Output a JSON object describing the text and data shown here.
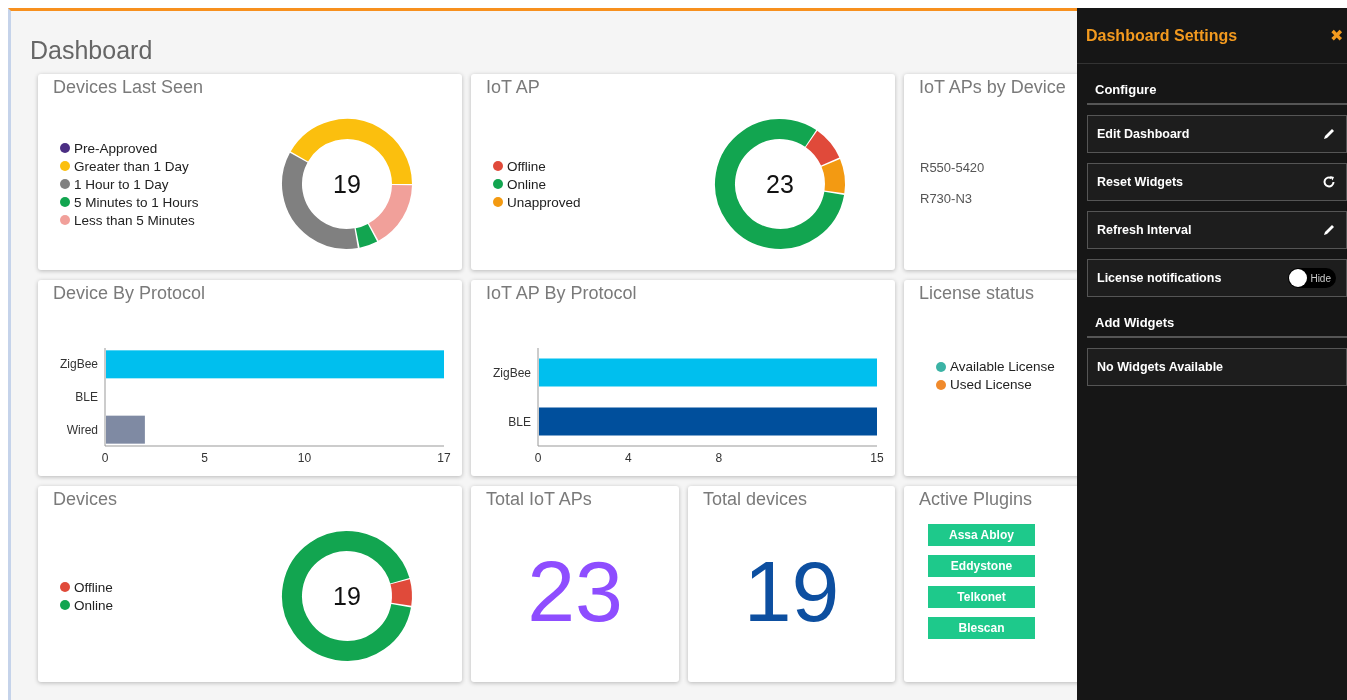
{
  "page": {
    "title": "Dashboard"
  },
  "widgets": [
    {
      "kind": "donut",
      "title": "Devices Last Seen",
      "total": "19",
      "legend": [
        {
          "label": "Pre-Approved",
          "color": "#4b2e83"
        },
        {
          "label": "Greater than 1 Day",
          "color": "#fbbf0e"
        },
        {
          "label": "1 Hour to 1 Day",
          "color": "#808080"
        },
        {
          "label": "5 Minutes to 1 Hours",
          "color": "#12a550"
        },
        {
          "label": "Less than 5 Minutes",
          "color": "#f1a09a"
        }
      ]
    },
    {
      "kind": "donut",
      "title": "IoT AP",
      "total": "23",
      "legend": [
        {
          "label": "Offline",
          "color": "#e04a3a"
        },
        {
          "label": "Online",
          "color": "#12a550"
        },
        {
          "label": "Unapproved",
          "color": "#f39a12"
        }
      ]
    },
    {
      "kind": "list",
      "title": "IoT APs by Device",
      "items": [
        "R550-5420",
        "R730-N3"
      ]
    },
    {
      "kind": "bar",
      "title": "Device By Protocol",
      "chart_data": {
        "type": "bar",
        "orientation": "horizontal",
        "categories": [
          "ZigBee",
          "BLE",
          "Wired"
        ],
        "series": [
          {
            "color": "#00bfee",
            "values": [
              17,
              null,
              null
            ]
          },
          {
            "color": "#7f8aa3",
            "values": [
              null,
              null,
              2
            ]
          }
        ],
        "xlim": [
          0,
          17
        ],
        "xticks": [
          0,
          5,
          10,
          17
        ]
      }
    },
    {
      "kind": "bar",
      "title": "IoT AP By Protocol",
      "chart_data": {
        "type": "bar",
        "orientation": "horizontal",
        "categories": [
          "ZigBee",
          "BLE"
        ],
        "series": [
          {
            "color": "#00bfee",
            "values": [
              15,
              null
            ]
          },
          {
            "color": "#004f9c",
            "values": [
              null,
              15
            ]
          }
        ],
        "xlim": [
          0,
          15
        ],
        "xticks": [
          0,
          4,
          8,
          15
        ]
      }
    },
    {
      "kind": "legend",
      "title": "License status",
      "legend": [
        {
          "label": "Available License",
          "color": "#3bb3a5"
        },
        {
          "label": "Used License",
          "color": "#f08a2c"
        }
      ]
    },
    {
      "kind": "donut",
      "title": "Devices",
      "total": "19",
      "legend": [
        {
          "label": "Offline",
          "color": "#e04a3a"
        },
        {
          "label": "Online",
          "color": "#12a550"
        }
      ]
    },
    {
      "kind": "count",
      "title": "Total IoT APs",
      "value": "23",
      "color": "#8e4dff"
    },
    {
      "kind": "count",
      "title": "Total devices",
      "value": "19",
      "color": "#0d4fa0"
    },
    {
      "kind": "plugins",
      "title": "Active Plugins",
      "plugins": [
        "Assa Abloy",
        "Eddystone",
        "Telkonet",
        "Blescan"
      ]
    }
  ],
  "settings_panel": {
    "title": "Dashboard Settings",
    "close": "✖",
    "sections": [
      {
        "heading": "Configure",
        "items": [
          {
            "kind": "edit",
            "label": "Edit Dashboard"
          },
          {
            "kind": "reset",
            "label": "Reset Widgets"
          },
          {
            "kind": "edit",
            "label": "Refresh Interval"
          },
          {
            "kind": "toggle",
            "label": "License notifications",
            "on": false,
            "toggle_label": "Hide"
          }
        ]
      },
      {
        "heading": "Add Widgets",
        "items": [
          {
            "kind": "note",
            "label": "No Widgets Available"
          }
        ]
      }
    ]
  }
}
